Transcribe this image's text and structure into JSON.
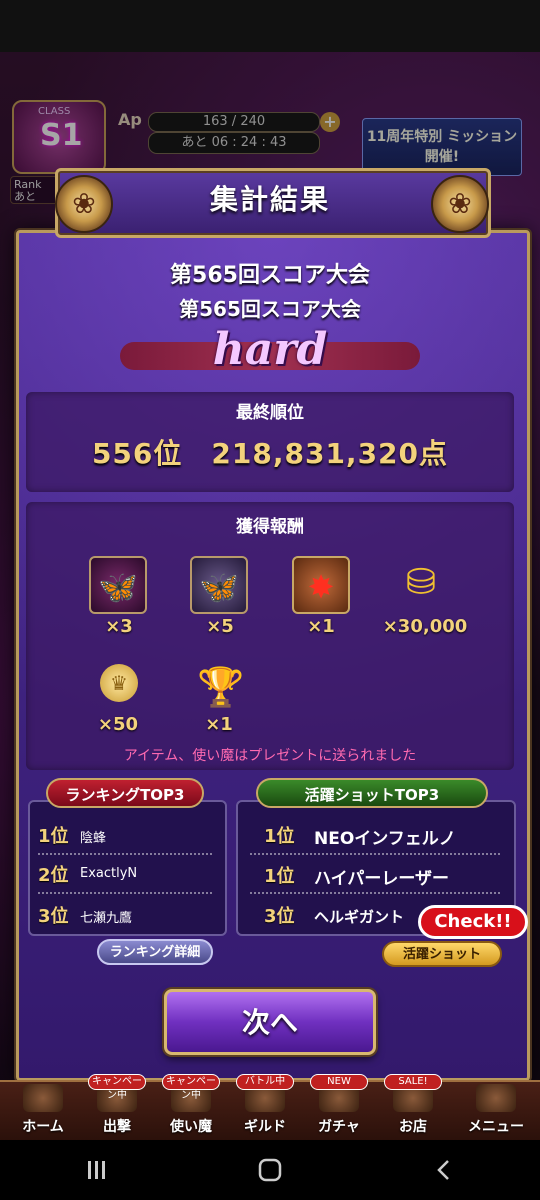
{
  "hud": {
    "class_label": "CLASS",
    "class_value": "S1",
    "rank_chip": "Rank あと",
    "ap_label": "Ap",
    "ap_value": "163 / 240",
    "ap_timer": "あと 06 : 24 : 43",
    "event_banner": "11周年特別 ミッション開催!"
  },
  "modal": {
    "title": "集計結果",
    "event_title_1": "第565回スコア大会",
    "event_title_2": "第565回スコア大会",
    "difficulty": "hard",
    "final_rank_heading": "最終順位",
    "final_rank_value": "556位　218,831,320点",
    "reward_heading": "獲得報酬",
    "rewards": [
      {
        "icon": "butterfly-crest-red-icon",
        "count": "×3"
      },
      {
        "icon": "butterfly-crest-silver-icon",
        "count": "×5"
      },
      {
        "icon": "red-gem-emblem-icon",
        "count": "×1"
      },
      {
        "icon": "gold-coins-icon",
        "count": "×30,000"
      },
      {
        "icon": "crown-medal-icon",
        "count": "×50"
      },
      {
        "icon": "trophy-icon",
        "count": "×1"
      }
    ],
    "present_note": "アイテム、使い魔はプレゼントに送られました",
    "ranking_top3": {
      "title": "ランキングTOP3",
      "rows": [
        {
          "rank": "1位",
          "name": "陰蜂"
        },
        {
          "rank": "2位",
          "name": "ExactlyN"
        },
        {
          "rank": "3位",
          "name": "七瀬九鷹"
        }
      ],
      "button": "ランキング詳細"
    },
    "shot_top3": {
      "title": "活躍ショットTOP3",
      "rows": [
        {
          "rank": "1位",
          "name": "NEOインフェルノ"
        },
        {
          "rank": "1位",
          "name": "ハイパーレーザー"
        },
        {
          "rank": "3位",
          "name": "ヘルギガント"
        }
      ],
      "button": "活躍ショット",
      "badge": "Check!!"
    },
    "next_button": "次へ"
  },
  "bottom_nav": [
    {
      "label": "ホーム",
      "tag": ""
    },
    {
      "label": "出撃",
      "tag": "キャンペーン中"
    },
    {
      "label": "使い魔",
      "tag": "キャンペーン中"
    },
    {
      "label": "ギルド",
      "tag": "バトル中"
    },
    {
      "label": "ガチャ",
      "tag": "NEW"
    },
    {
      "label": "お店",
      "tag": "SALE!"
    },
    {
      "label": "メニュー",
      "tag": ""
    }
  ]
}
